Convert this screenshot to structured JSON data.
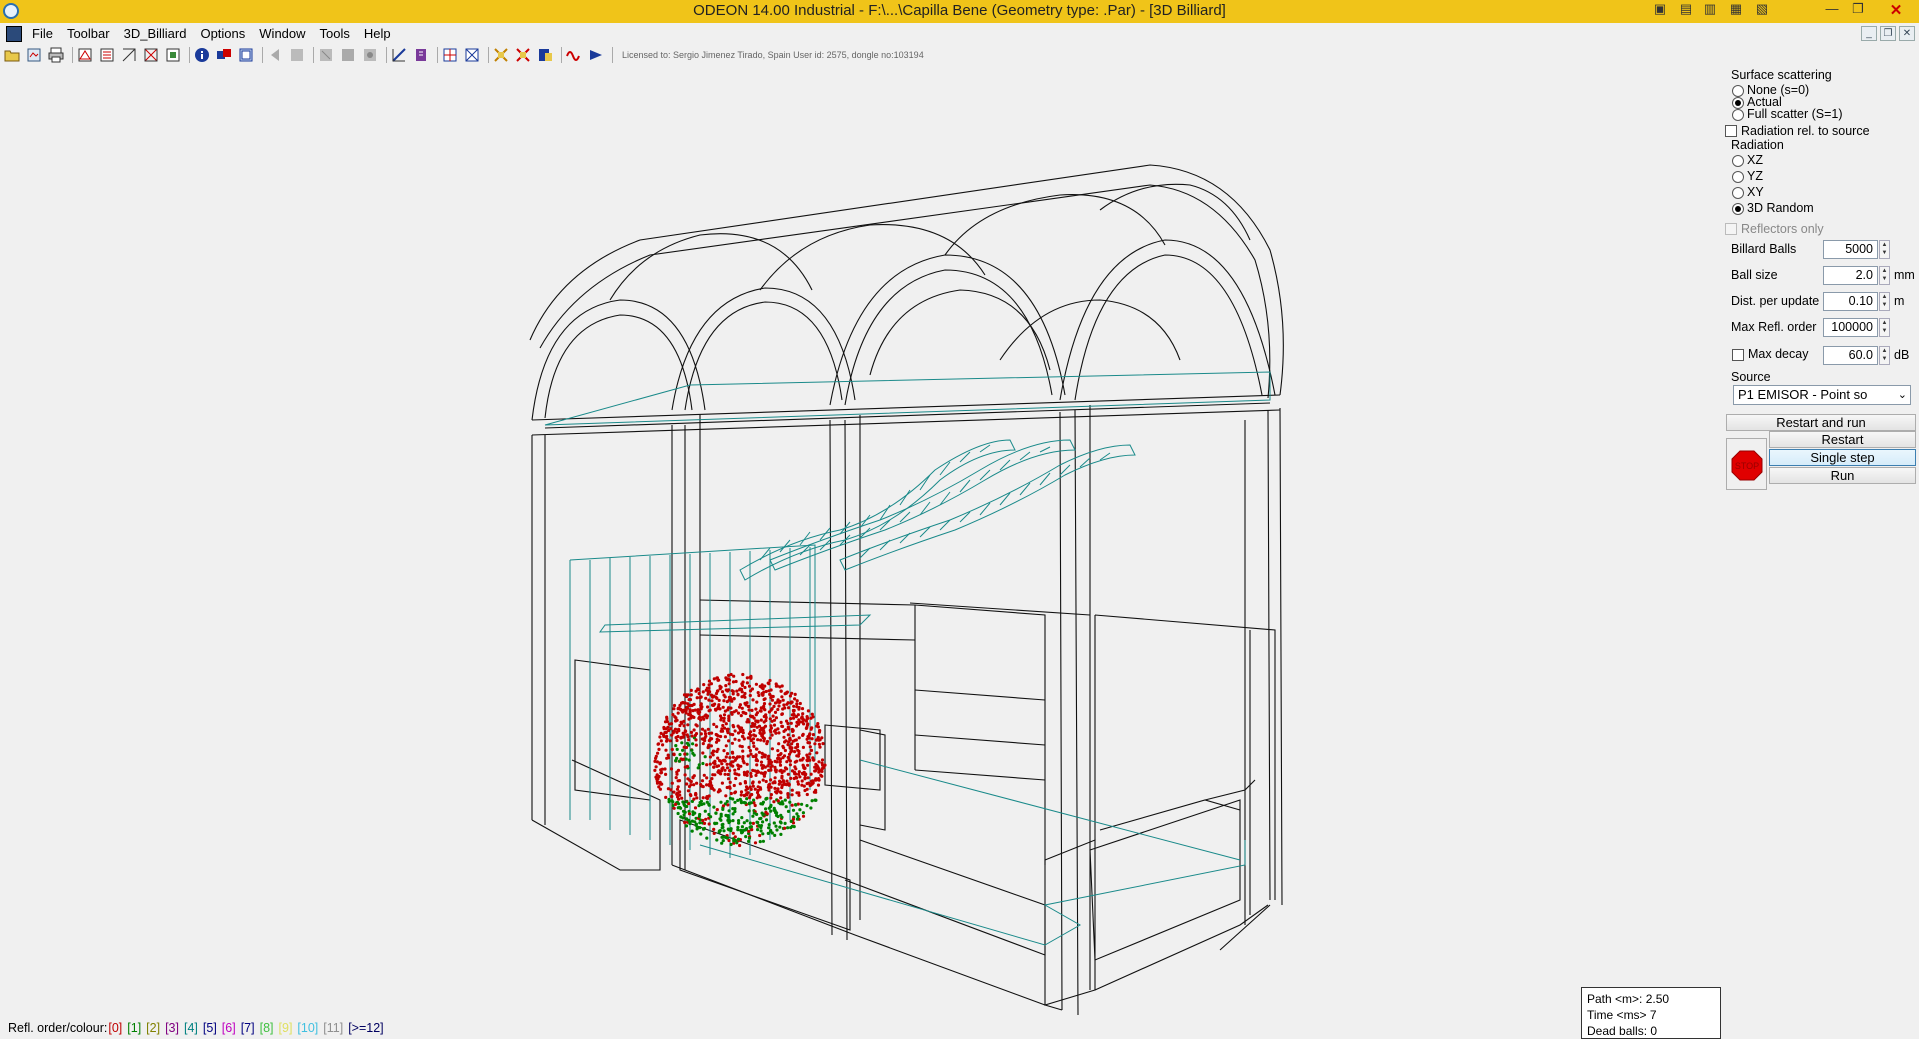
{
  "window": {
    "title": "ODEON 14.00 Industrial  -  F:\\...\\Capilla  Bene     (Geometry type: .Par) - [3D Billiard]"
  },
  "menu": [
    "File",
    "Toolbar",
    "3D_Billiard",
    "Options",
    "Window",
    "Tools",
    "Help"
  ],
  "toolbar": {
    "license": "Licensed to: Sergio Jimenez Tirado, Spain    User id: 2575, dongle no:103194"
  },
  "panel": {
    "scattering_title": "Surface scattering",
    "scattering_options": [
      "None (s=0)",
      "Actual",
      "Full scatter (S=1)"
    ],
    "radiation_rel_label": "Radiation rel. to source",
    "radiation_title": "Radiation",
    "radiation_options": [
      "XZ",
      "YZ",
      "XY",
      "3D Random"
    ],
    "reflectors_only": "Reflectors only",
    "billiard_balls_label": "Billard Balls",
    "billiard_balls_value": "5000",
    "ball_size_label": "Ball size",
    "ball_size_value": "2.0",
    "ball_size_unit": "mm",
    "dist_label": "Dist. per update",
    "dist_value": "0.10",
    "dist_unit": "m",
    "max_refl_label": "Max Refl. order",
    "max_refl_value": "100000",
    "max_decay_label": "Max decay",
    "max_decay_value": "60.0",
    "max_decay_unit": "dB",
    "source_label": "Source",
    "source_value": "P1 EMISOR  -  Point so",
    "restart_run": "Restart and run",
    "restart": "Restart",
    "single_step": "Single step",
    "run": "Run",
    "stop": "STOP"
  },
  "legend": {
    "label": "Refl. order/colour:",
    "items": [
      {
        "text": "[0]",
        "color": "#c00000"
      },
      {
        "text": "[1]",
        "color": "#008000"
      },
      {
        "text": "[2]",
        "color": "#808000"
      },
      {
        "text": "[3]",
        "color": "#800080"
      },
      {
        "text": "[4]",
        "color": "#008080"
      },
      {
        "text": "[5]",
        "color": "#000080"
      },
      {
        "text": "[6]",
        "color": "#c000c0"
      },
      {
        "text": "[7]",
        "color": "#000080"
      },
      {
        "text": "[8]",
        "color": "#40c040"
      },
      {
        "text": "[9]",
        "color": "#e0e060"
      },
      {
        "text": "[10]",
        "color": "#40c0e0"
      },
      {
        "text": "[11]",
        "color": "#909090"
      },
      {
        "text": "[>=12]",
        "color": "#000060"
      }
    ]
  },
  "status": {
    "path": "Path <m>:  2.50",
    "time": "Time <ms> 7",
    "dead": "Dead balls:  0"
  }
}
